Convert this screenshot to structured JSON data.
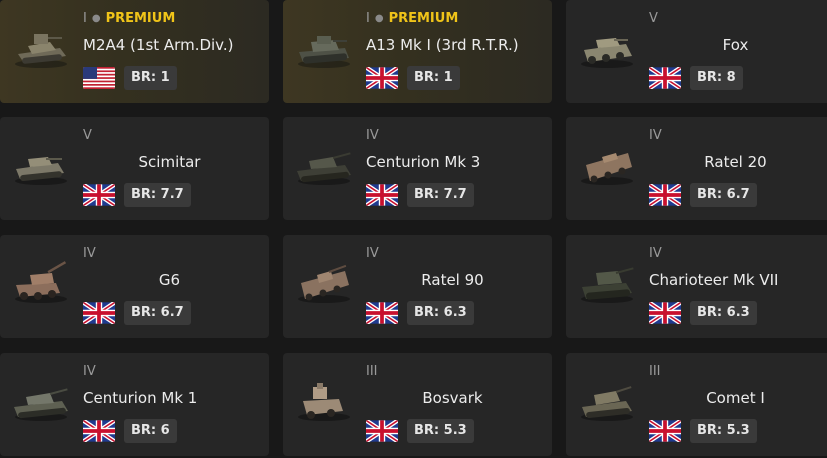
{
  "colors": {
    "background": "#181818",
    "card": "#262626",
    "premium_card": "#3e3722",
    "premium_label": "#f0c419",
    "br_badge": "#3a3a3a"
  },
  "vehicles": [
    {
      "tier": "I",
      "premium_label": "PREMIUM",
      "name": "M2A4 (1st Arm.Div.)",
      "flag": "usa-flag-icon",
      "br": "BR: 1",
      "premium": true
    },
    {
      "tier": "I",
      "premium_label": "PREMIUM",
      "name": "A13 Mk I (3rd R.T.R.)",
      "flag": "uk-flag-icon",
      "br": "BR: 1",
      "premium": true
    },
    {
      "tier": "V",
      "name": "Fox",
      "flag": "uk-flag-icon",
      "br": "BR: 8"
    },
    {
      "tier": "V",
      "name": "Scimitar",
      "flag": "uk-flag-icon",
      "br": "BR: 7.7"
    },
    {
      "tier": "IV",
      "name": "Centurion Mk 3",
      "flag": "uk-flag-icon",
      "br": "BR: 7.7"
    },
    {
      "tier": "IV",
      "name": "Ratel 20",
      "flag": "uk-flag-icon",
      "br": "BR: 6.7"
    },
    {
      "tier": "IV",
      "name": "G6",
      "flag": "uk-flag-icon",
      "br": "BR: 6.7"
    },
    {
      "tier": "IV",
      "name": "Ratel 90",
      "flag": "uk-flag-icon",
      "br": "BR: 6.3"
    },
    {
      "tier": "IV",
      "name": "Charioteer Mk VII",
      "flag": "uk-flag-icon",
      "br": "BR: 6.3"
    },
    {
      "tier": "IV",
      "name": "Centurion Mk 1",
      "flag": "uk-flag-icon",
      "br": "BR: 6"
    },
    {
      "tier": "III",
      "name": "Bosvark",
      "flag": "uk-flag-icon",
      "br": "BR: 5.3"
    },
    {
      "tier": "III",
      "name": "Comet I",
      "flag": "uk-flag-icon",
      "br": "BR: 5.3"
    }
  ]
}
